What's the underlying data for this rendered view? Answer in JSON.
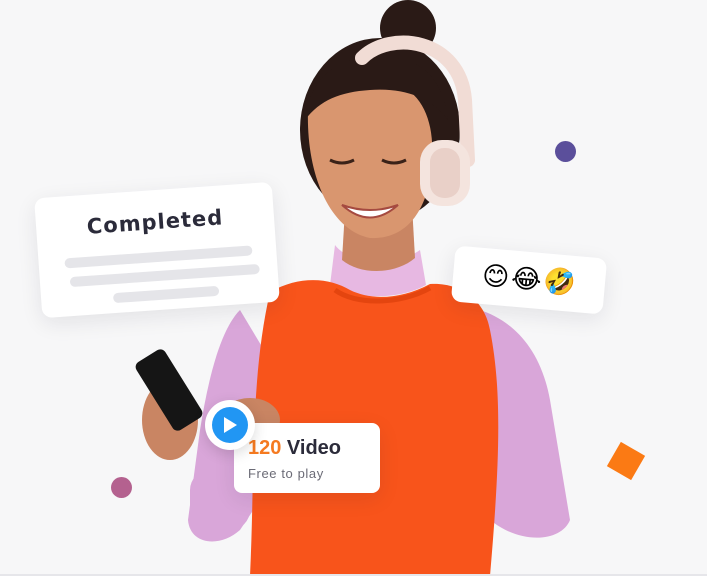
{
  "completed_card": {
    "title": "Completed"
  },
  "emoji_card": {
    "emojis": [
      "😊",
      "😂",
      "🤣"
    ]
  },
  "video_card": {
    "count": "120",
    "label": " Video",
    "subtitle": "Free to play"
  },
  "icons": {
    "play": "play-icon",
    "headphones": "headphones-icon",
    "phone": "phone-icon"
  },
  "colors": {
    "background": "#f7f7f8",
    "accent_orange": "#f57a20",
    "play_blue": "#2196f3",
    "dot_purple": "#5b4f9b",
    "dot_mauve": "#b4618f",
    "shirt_lilac": "#d9a6d9",
    "vest_orange": "#f8541b"
  }
}
